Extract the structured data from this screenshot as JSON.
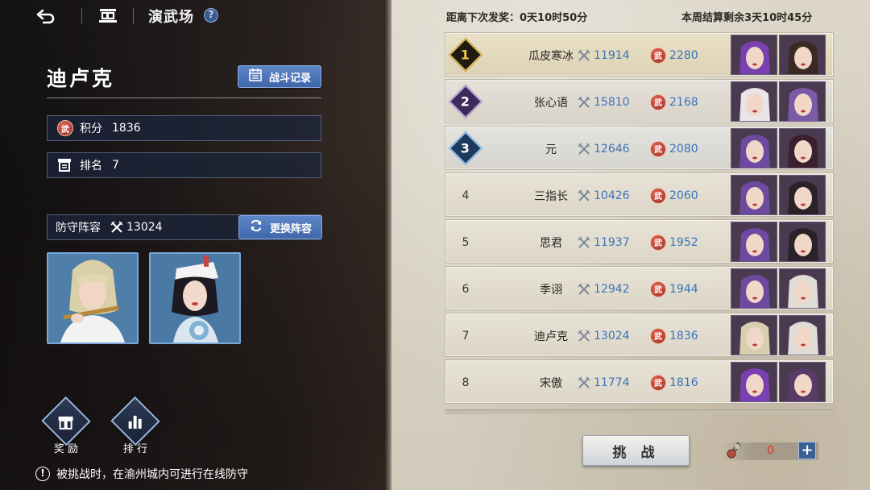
{
  "header": {
    "title": "演武场",
    "back_icon": "back-arrow-icon",
    "home_icon": "home-icon",
    "help_icon": "help-icon",
    "help_glyph": "?"
  },
  "player": {
    "name": "迪卢克",
    "battle_log_label": "战斗记录",
    "score_label": "积分",
    "score_value": "1836",
    "rank_label": "排名",
    "rank_value": "7",
    "defense_label": "防守阵容",
    "defense_power": "13024",
    "change_lineup_label": "更换阵容",
    "wu_glyph": "武"
  },
  "bottom_buttons": {
    "reward_label": "奖 励",
    "ranking_label": "排 行"
  },
  "notice": {
    "text": "被挑战时，在渝州城内可进行在线防守",
    "glyph": "!"
  },
  "ranking": {
    "next_reward": "距离下次发奖：0天10时50分",
    "settlement": "本周结算剩余3天10时45分",
    "rows": [
      {
        "rank": "1",
        "name": "瓜皮寒冰",
        "power": "11914",
        "score": "2280"
      },
      {
        "rank": "2",
        "name": "张心语",
        "power": "15810",
        "score": "2168"
      },
      {
        "rank": "3",
        "name": "元",
        "power": "12646",
        "score": "2080"
      },
      {
        "rank": "4",
        "name": "三指长",
        "power": "10426",
        "score": "2060"
      },
      {
        "rank": "5",
        "name": "思君",
        "power": "11937",
        "score": "1952"
      },
      {
        "rank": "6",
        "name": "季诩",
        "power": "12942",
        "score": "1944"
      },
      {
        "rank": "7",
        "name": "迪卢克",
        "power": "13024",
        "score": "1836"
      },
      {
        "rank": "8",
        "name": "宋傲",
        "power": "11774",
        "score": "1816"
      }
    ]
  },
  "challenge": {
    "label": "挑 战",
    "tickets": "0",
    "add_glyph": "+"
  },
  "colors": {
    "accent_blue": "#3a74b8",
    "button_blue": "#4a72b6",
    "ticket_red": "#d33a2a"
  }
}
